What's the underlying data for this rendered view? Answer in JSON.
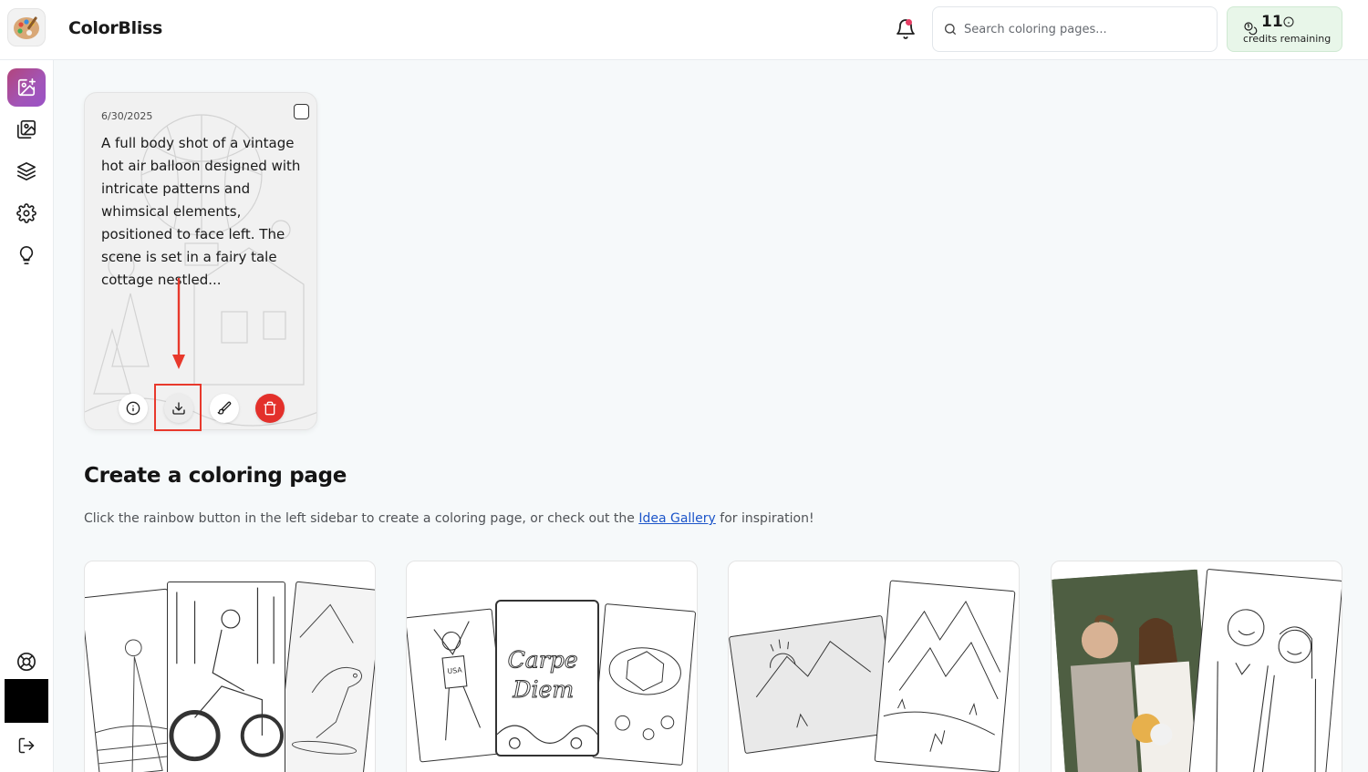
{
  "header": {
    "brand": "ColorBliss",
    "search_placeholder": "Search coloring pages...",
    "credits_count": "11",
    "credits_label": "credits remaining"
  },
  "sidebar": {
    "items": [
      {
        "name": "create",
        "icon": "image-plus-icon",
        "active": true
      },
      {
        "name": "gallery",
        "icon": "images-icon",
        "active": false
      },
      {
        "name": "collections",
        "icon": "layers-icon",
        "active": false
      },
      {
        "name": "settings",
        "icon": "gear-icon",
        "active": false
      },
      {
        "name": "ideas",
        "icon": "lightbulb-icon",
        "active": false
      }
    ],
    "bottom_items": [
      {
        "name": "help",
        "icon": "lifebuoy-icon"
      },
      {
        "name": "logout",
        "icon": "logout-icon"
      }
    ]
  },
  "card": {
    "date": "6/30/2025",
    "description": "A full body shot of a vintage hot air balloon designed with intricate patterns and whimsical elements, positioned to face left. The scene is set in a fairy tale cottage nestled...",
    "actions": [
      "info-icon",
      "download-icon",
      "brush-icon",
      "trash-icon"
    ]
  },
  "section": {
    "title": "Create a coloring page",
    "desc_before": "Click the rainbow button in the left sidebar to create a coloring page, or check out the ",
    "desc_link": "Idea Gallery",
    "desc_after": " for inspiration!"
  },
  "gallery_cards": [
    {
      "theme": "character-pages"
    },
    {
      "theme": "text-and-sports-pages"
    },
    {
      "theme": "sketch-to-page"
    },
    {
      "theme": "photo-to-page"
    }
  ],
  "colors": {
    "accent": "#a255b8",
    "delete": "#e3302b",
    "credits_bg": "#e8f6e9",
    "link": "#1c55c9",
    "highlight": "#e8392c"
  }
}
